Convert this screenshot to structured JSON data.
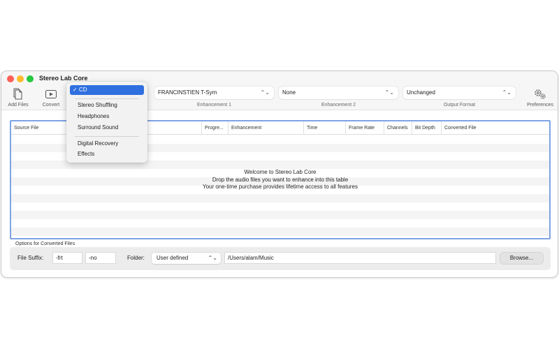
{
  "window": {
    "title": "Stereo Lab Core"
  },
  "toolbar": {
    "add_files": "Add Files",
    "convert": "Convert",
    "enhancement1": {
      "value": "FRANCINSTIEN T-Sym",
      "label": "Enhancement 1"
    },
    "enhancement2": {
      "value": "None",
      "label": "Enhancement 2"
    },
    "output_format": {
      "value": "Unchanged",
      "label": "Output Format"
    },
    "preferences": "Preferences"
  },
  "dropdown": {
    "selected": "CD",
    "groups": [
      [
        "Stereo Shuffling",
        "Headphones",
        "Surround Sound"
      ],
      [
        "Digital Recovery",
        "Effects"
      ]
    ]
  },
  "table": {
    "columns": [
      "Source File",
      "Progre...",
      "Enhancement",
      "Time",
      "Frame Rate",
      "Channels",
      "Bit Depth",
      "Converted File"
    ],
    "welcome": [
      "Welcome to Stereo Lab Core",
      "Drop the audio files you want to enhance into this table",
      "Your one-time purchase provides lifetime access to all features"
    ]
  },
  "options": {
    "title": "Options for Converted Files",
    "file_suffix_label": "File Suffix:",
    "suffix1": "-frt",
    "suffix2": "-no",
    "folder_label": "Folder:",
    "folder_select": "User defined",
    "folder_path": "/Users/alam/Music",
    "browse": "Browse..."
  }
}
